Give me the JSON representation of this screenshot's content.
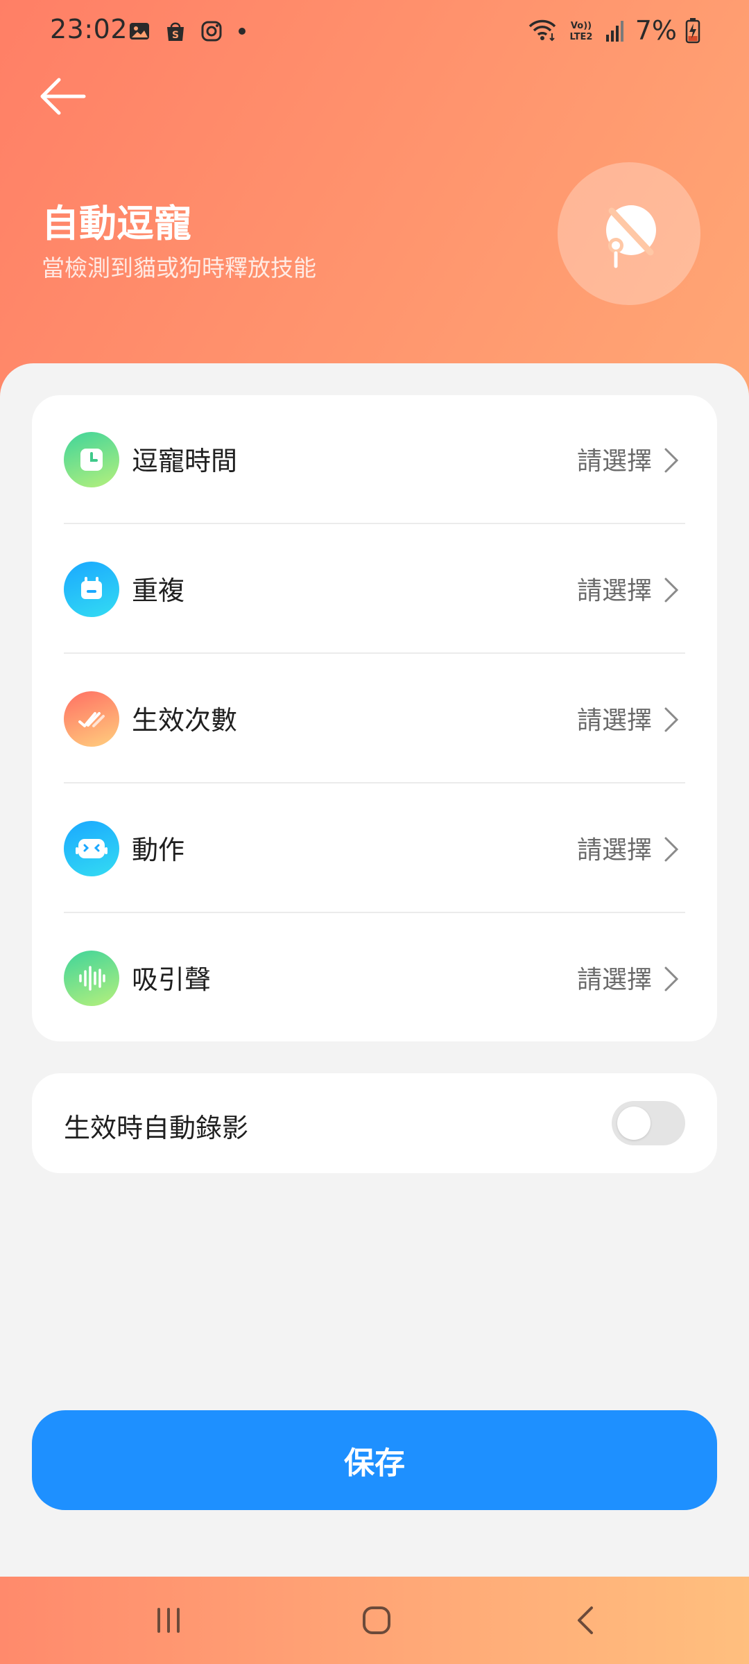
{
  "status_bar": {
    "time": "23:02",
    "battery": "7%",
    "icons": [
      "gallery-icon",
      "shopee-icon",
      "instagram-icon",
      "notification-dot",
      "wifi-icon",
      "volte-icon",
      "signal-icon",
      "battery-charging-icon"
    ],
    "volte_text": "Vo)) LTE2"
  },
  "header": {
    "title": "自動逗寵",
    "subtitle": "當檢測到貓或狗時釋放技能",
    "badge_icon": "cat-toy-off-icon"
  },
  "settings": {
    "items": [
      {
        "label": "逗寵時間",
        "value": "請選擇",
        "icon": "clock-icon"
      },
      {
        "label": "重複",
        "value": "請選擇",
        "icon": "calendar-icon"
      },
      {
        "label": "生效次數",
        "value": "請選擇",
        "icon": "double-check-icon"
      },
      {
        "label": "動作",
        "value": "請選擇",
        "icon": "robot-face-icon"
      },
      {
        "label": "吸引聲",
        "value": "請選擇",
        "icon": "sound-wave-icon"
      }
    ]
  },
  "auto_record": {
    "label": "生效時自動錄影",
    "enabled": false
  },
  "save_label": "保存",
  "nav": {
    "icons": [
      "recent-apps-icon",
      "home-icon",
      "back-nav-icon"
    ]
  },
  "colors": {
    "accent": "#1e90ff",
    "header_gradient_start": "#ff7f66",
    "header_gradient_end": "#ffbd7d",
    "sheet_bg": "#f3f3f3"
  }
}
